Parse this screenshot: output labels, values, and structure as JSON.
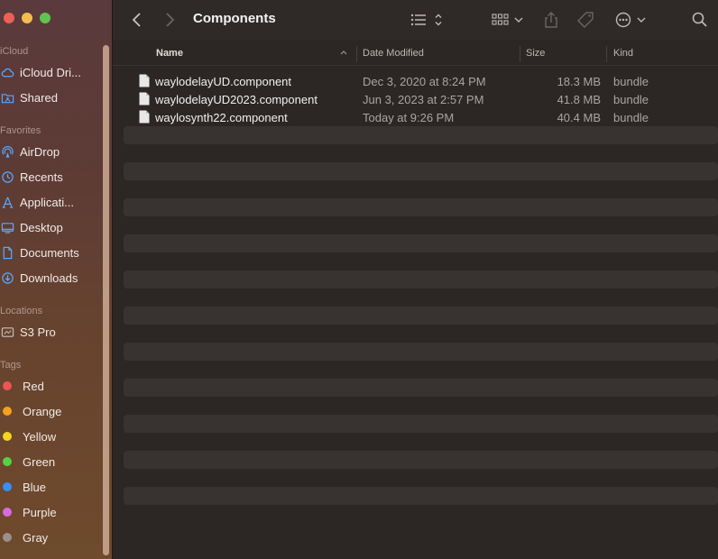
{
  "sidebar": {
    "sections": {
      "icloud": "iCloud",
      "favorites": "Favorites",
      "locations": "Locations",
      "tags": "Tags"
    },
    "icloud_items": [
      {
        "label": "iCloud Dri...",
        "icon": "cloud-icon"
      },
      {
        "label": "Shared",
        "icon": "shared-folder-icon"
      }
    ],
    "favorite_items": [
      {
        "label": "AirDrop",
        "icon": "airdrop-icon"
      },
      {
        "label": "Recents",
        "icon": "clock-icon"
      },
      {
        "label": "Applicati...",
        "icon": "applications-icon"
      },
      {
        "label": "Desktop",
        "icon": "desktop-icon"
      },
      {
        "label": "Documents",
        "icon": "document-icon"
      },
      {
        "label": "Downloads",
        "icon": "download-icon"
      }
    ],
    "location_items": [
      {
        "label": "S3 Pro",
        "icon": "disk-icon"
      }
    ],
    "tags": [
      {
        "label": "Red",
        "color": "#ee5452"
      },
      {
        "label": "Orange",
        "color": "#f5a020"
      },
      {
        "label": "Yellow",
        "color": "#f6d31f"
      },
      {
        "label": "Green",
        "color": "#56d146"
      },
      {
        "label": "Blue",
        "color": "#3a8ef5"
      },
      {
        "label": "Purple",
        "color": "#d86be0"
      },
      {
        "label": "Gray",
        "color": "#9c8f8c"
      }
    ]
  },
  "toolbar": {
    "title": "Components",
    "back_icon": "chevron-left-icon",
    "forward_icon": "chevron-right-icon",
    "view_icon": "list-view-icon",
    "group_icon": "grid-group-icon",
    "share_icon": "share-icon",
    "tag_icon": "tag-icon",
    "more_icon": "ellipsis-circle-icon",
    "search_icon": "search-icon"
  },
  "columns": {
    "name": "Name",
    "date": "Date Modified",
    "size": "Size",
    "kind": "Kind"
  },
  "files": [
    {
      "name": "waylodelayUD.component",
      "date": "Dec 3, 2020 at 8:24 PM",
      "size": "18.3 MB",
      "kind": "bundle"
    },
    {
      "name": "waylodelayUD2023.component",
      "date": "Jun 3, 2023 at 2:57 PM",
      "size": "41.8 MB",
      "kind": "bundle"
    },
    {
      "name": "waylosynth22.component",
      "date": "Today at 9:26 PM",
      "size": "40.4 MB",
      "kind": "bundle"
    }
  ]
}
